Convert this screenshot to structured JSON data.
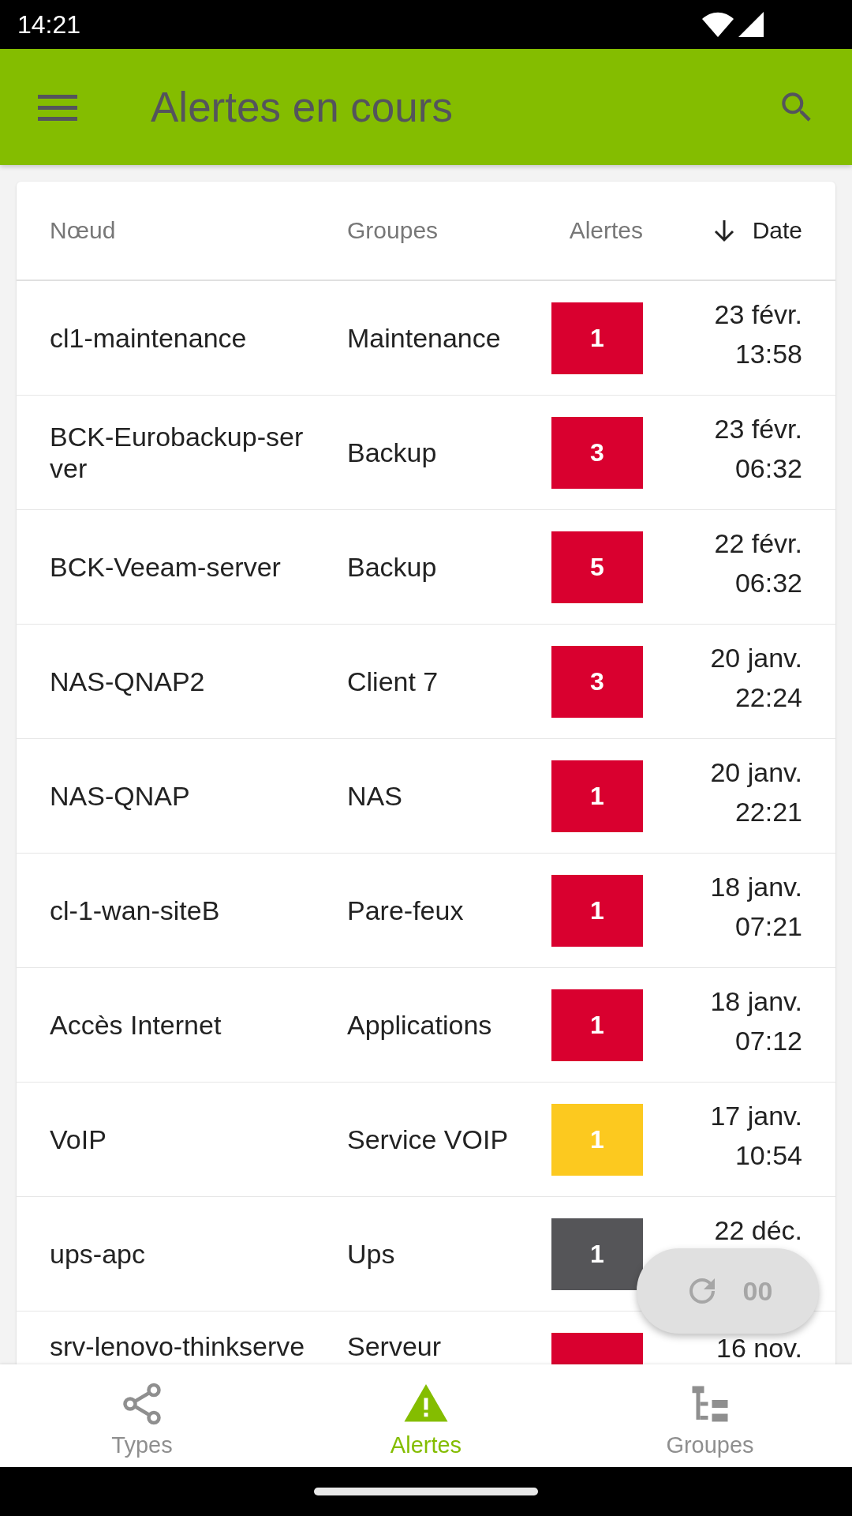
{
  "status_bar": {
    "time": "14:21"
  },
  "app_bar": {
    "title": "Alertes en cours"
  },
  "table": {
    "columns": [
      {
        "label": "Nœud",
        "sorted": false
      },
      {
        "label": "Groupes",
        "sorted": false
      },
      {
        "label": "Alertes",
        "sorted": false
      },
      {
        "label": "Date",
        "sorted": true
      }
    ],
    "rows": [
      {
        "node": "cl1-maintenance",
        "group": "Maintenance",
        "count": "1",
        "color": "#d9002f",
        "date": "23 févr.",
        "time": "13:58"
      },
      {
        "node": "BCK-Eurobackup-ser ver",
        "group": "Backup",
        "count": "3",
        "color": "#d9002f",
        "date": "23 févr.",
        "time": "06:32"
      },
      {
        "node": "BCK-Veeam-server",
        "group": "Backup",
        "count": "5",
        "color": "#d9002f",
        "date": "22 févr.",
        "time": "06:32"
      },
      {
        "node": "NAS-QNAP2",
        "group": "Client 7",
        "count": "3",
        "color": "#d9002f",
        "date": "20 janv.",
        "time": "22:24"
      },
      {
        "node": "NAS-QNAP",
        "group": "NAS",
        "count": "1",
        "color": "#d9002f",
        "date": "20 janv.",
        "time": "22:21"
      },
      {
        "node": "cl-1-wan-siteB",
        "group": "Pare-feux",
        "count": "1",
        "color": "#d9002f",
        "date": "18 janv.",
        "time": "07:21"
      },
      {
        "node": "Accès Internet",
        "group": "Applications",
        "count": "1",
        "color": "#d9002f",
        "date": "18 janv.",
        "time": "07:12"
      },
      {
        "node": "VoIP",
        "group": "Service VOIP",
        "count": "1",
        "color": "#fcc91f",
        "date": "17 janv.",
        "time": "10:54"
      },
      {
        "node": "ups-apc",
        "group": "Ups",
        "count": "1",
        "color": "#555558",
        "date": "22 déc."
      },
      {
        "node": "srv-lenovo-thinkserve",
        "group": "Serveur",
        "color": "#d9002f",
        "date": "16 nov."
      }
    ]
  },
  "refresh_button": {
    "label": "00"
  },
  "bottom_nav": [
    {
      "kind": "share",
      "label": "Types",
      "selected": false
    },
    {
      "kind": "warning",
      "label": "Alertes",
      "selected": true
    },
    {
      "kind": "tree",
      "label": "Groupes",
      "selected": false
    }
  ]
}
